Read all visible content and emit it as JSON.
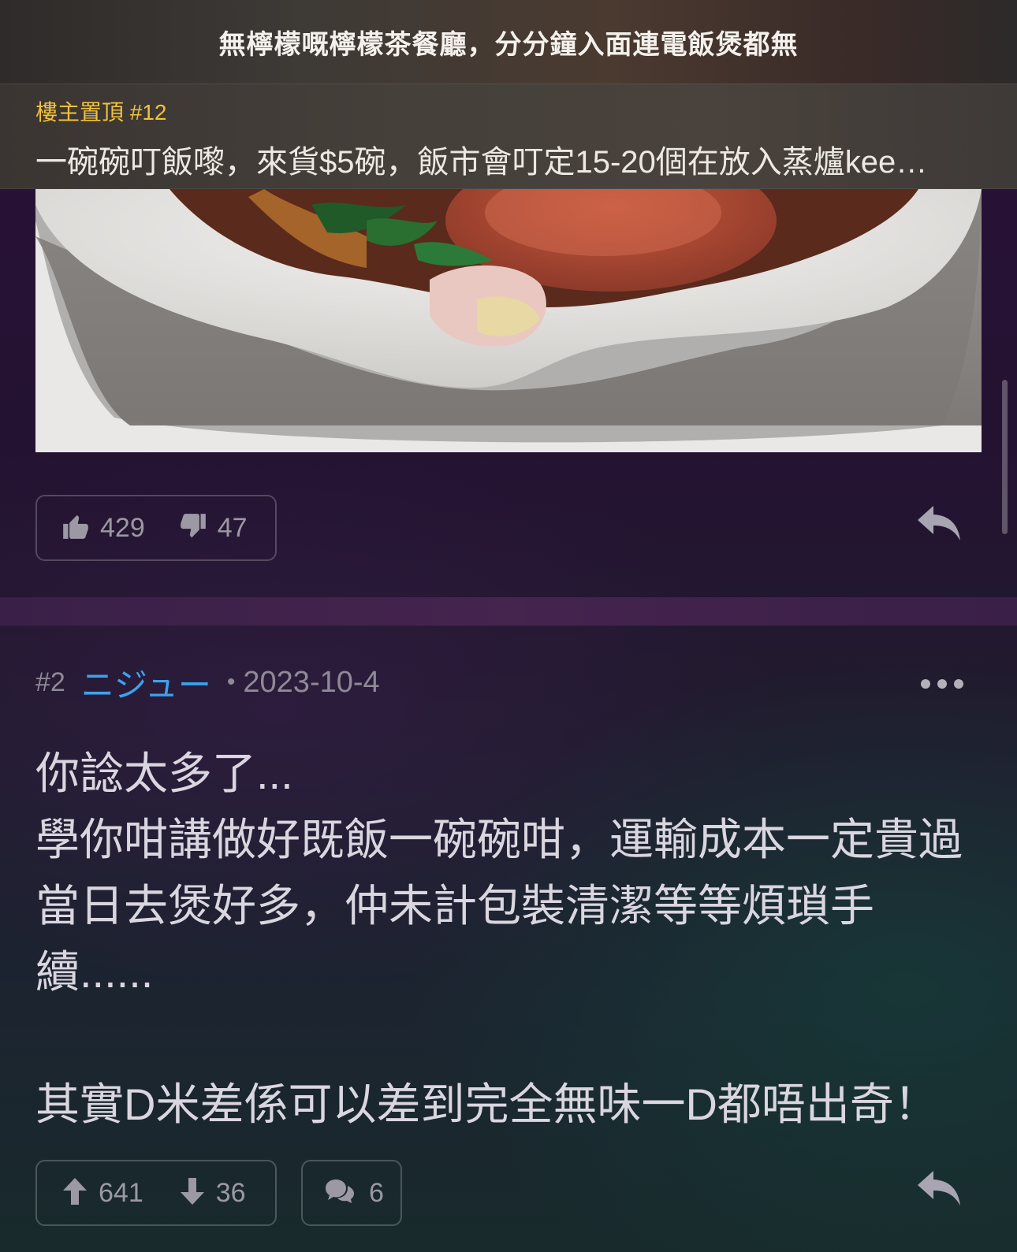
{
  "header": {
    "title": "無檸檬嘅檸檬茶餐廳，分分鐘入面連電飯煲都無"
  },
  "pinned": {
    "label": "樓主置頂 #12",
    "text": "一碗碗叮飯嚟，來貨$5碗，飯市會叮定15-20個在放入蒸爐kee…"
  },
  "post1": {
    "likes": "429",
    "dislikes": "47"
  },
  "post2": {
    "number": "#2",
    "username": "ニジュー",
    "separator": "•",
    "date": "2023-10-4",
    "body_lines": [
      "你諗太多了...",
      "學你咁講做好既飯一碗碗咁，運輸成本一定貴過",
      "當日去煲好多，仲未計包裝清潔等等煩瑣手",
      "續......",
      "",
      "其實D米差係可以差到完全無味一D都唔出奇！"
    ],
    "upvotes": "641",
    "downvotes": "36",
    "comments": "6"
  },
  "colors": {
    "pinned_label": "#f2c23a",
    "username": "#3aa3f0",
    "muted": "#8e8a96"
  }
}
